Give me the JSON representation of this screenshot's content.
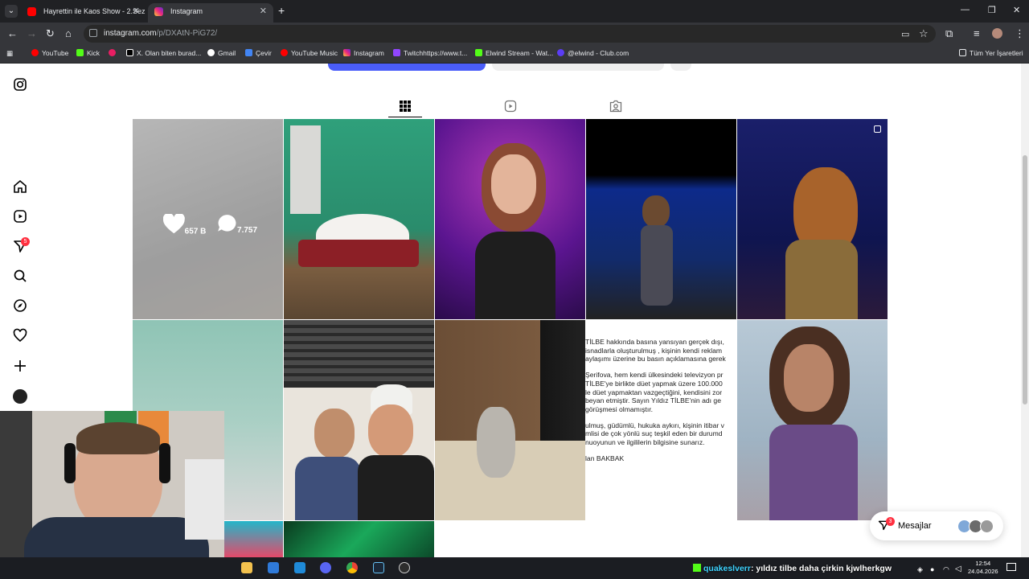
{
  "browser": {
    "tabs": [
      {
        "title": "Hayrettin ile Kaos Show - 2.Sez",
        "active": false
      },
      {
        "title": "Instagram",
        "active": true
      }
    ],
    "url_host": "instagram.com",
    "url_path": "/p/DXAtN-PiG72/",
    "bookmarks": [
      "YouTube",
      "Kick",
      "X. Olan biten burad...",
      "Gmail",
      "Çevir",
      "YouTube Music",
      "Instagram",
      "Twitchhttps://www.t...",
      "Elwind Stream - Wat...",
      "@elwind - Club.com"
    ],
    "bookmarks_all": "Tüm Yer İşaretleri"
  },
  "instagram": {
    "notification_count": "5",
    "hovered_post": {
      "likes": "657 B",
      "comments": "7.757"
    },
    "news_text": [
      "TİLBE hakkında basına yansıyan gerçek dışı,",
      " isnadlarla oluşturulmuş , kişinin kendi reklam",
      "aylaşımı üzerine bu basın açıklamasına gerek",
      "Şerifova, hem kendi ülkesindeki televizyon pr",
      "TİLBE'ye birlikte düet yapmak üzere 100.000",
      "le düet yapmaktan vazgeçtiğini, kendisini zor",
      " beyan etmiştir. Sayın Yıldız TİLBE'nin adı ge",
      " görüşmesi olmamıştır.",
      "ulmuş, güdümlü, hukuka aykırı, kişinin itibar v",
      "mlisi de çok yönlü suç teşkil eden bir durumd",
      "nuoyunun ve ilgililerin bilgisine sunarız.",
      "lan BAKBAK"
    ],
    "messages_label": "Mesajlar",
    "messages_count": "3"
  },
  "stream": {
    "chat_user": "quakeslverr",
    "chat_message": ": yıldız tilbe daha çirkin kjwlherkgw"
  },
  "taskbar": {
    "time": "12:54",
    "date": "24.04.2026"
  }
}
